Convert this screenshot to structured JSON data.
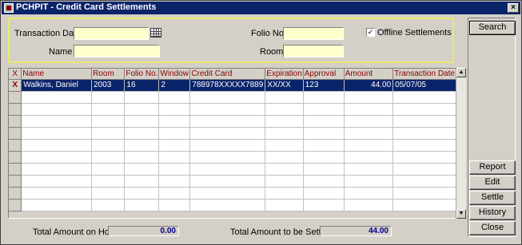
{
  "window": {
    "title": "PCHPIT - Credit Card Settlements",
    "close_glyph": "×"
  },
  "search": {
    "transaction_date_label": "Transaction Date",
    "transaction_date_value": "",
    "name_label": "Name",
    "name_value": "",
    "folio_label": "Folio No.",
    "folio_value": "",
    "room_label": "Room",
    "room_value": "",
    "offline_label": "Offline Settlements",
    "offline_checked": "✓"
  },
  "buttons": {
    "search": "Search",
    "report": "Report",
    "edit": "Edit",
    "settle": "Settle",
    "history": "History",
    "close": "Close"
  },
  "grid": {
    "columns": [
      "X",
      "Name",
      "Room",
      "Folio No.",
      "Window",
      "Credit Card",
      "Expiration",
      "Approval",
      "Amount",
      "Transaction Date"
    ],
    "rows": [
      {
        "marker": "X",
        "name": "Walkins, Daniel",
        "room": "2003",
        "folio": "16",
        "window": "2",
        "card": "788978XXXXX7889",
        "expiration": "XX/XX",
        "approval": "123",
        "amount": "44.00",
        "date": "05/07/05"
      }
    ]
  },
  "totals": {
    "on_hold_label": "Total Amount on Hold",
    "on_hold_value": "0.00",
    "to_settle_label": "Total Amount to be Settled",
    "to_settle_value": "44.00"
  }
}
